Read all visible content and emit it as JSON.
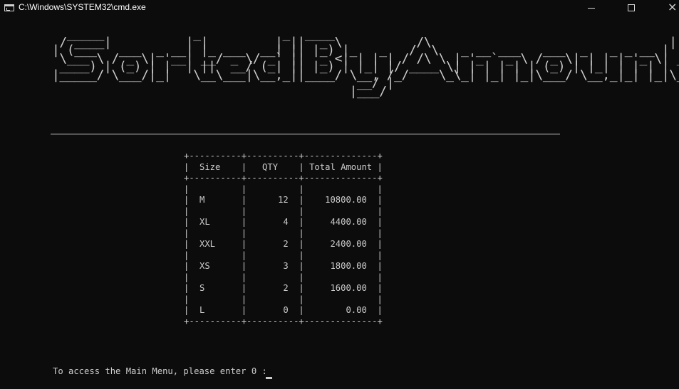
{
  "window": {
    "title": "C:\\Windows\\SYSTEM32\\cmd.exe",
    "controls": {
      "minimize": "minimize",
      "maximize": "maximize",
      "close": "×"
    }
  },
  "banner": {
    "text": "SortedByAmount",
    "ascii": "  _____            _           _  ____                                               _\n / ____|          | |         | ||  _ \\          /\\                                | |\n| (___   ___  _ __| |_ ___  __| || |_) |_   _   /  \\   _ __ ___   ___  _   _ _ __ | |_\n \\___ \\ / _ \\| '__| __/ _ \\/ _` ||  _ <| | | | / /\\ \\ | '_ ` _ \\ / _ \\| | | | '_ \\| __|\n ____) | (_) | |  | ||  __/ (_| || |_) | |_| |/ ____ \\| | | | | | (_) | |_| | | | | |_\n|_____/ \\___/|_|   \\__\\___|\\__,_||____/ \\__, /_/    \\_\\_| |_| |_|\\___/ \\__,_|_| |_|\\__|\n                                         __/ |\n                                        |___/"
  },
  "table": {
    "headers": [
      "Size",
      "QTY",
      "Total Amount"
    ],
    "rows": [
      {
        "size": "M",
        "qty": "12",
        "total": "10800.00"
      },
      {
        "size": "XL",
        "qty": "4",
        "total": "4400.00"
      },
      {
        "size": "XXL",
        "qty": "2",
        "total": "2400.00"
      },
      {
        "size": "XS",
        "qty": "3",
        "total": "1800.00"
      },
      {
        "size": "S",
        "qty": "2",
        "total": "1600.00"
      },
      {
        "size": "L",
        "qty": "0",
        "total": "0.00"
      }
    ]
  },
  "prompt": {
    "text": "To access the Main Menu, please enter 0 :"
  },
  "colors": {
    "background": "#0c0c0c",
    "foreground": "#cccccc",
    "title_text": "#ffffff"
  }
}
